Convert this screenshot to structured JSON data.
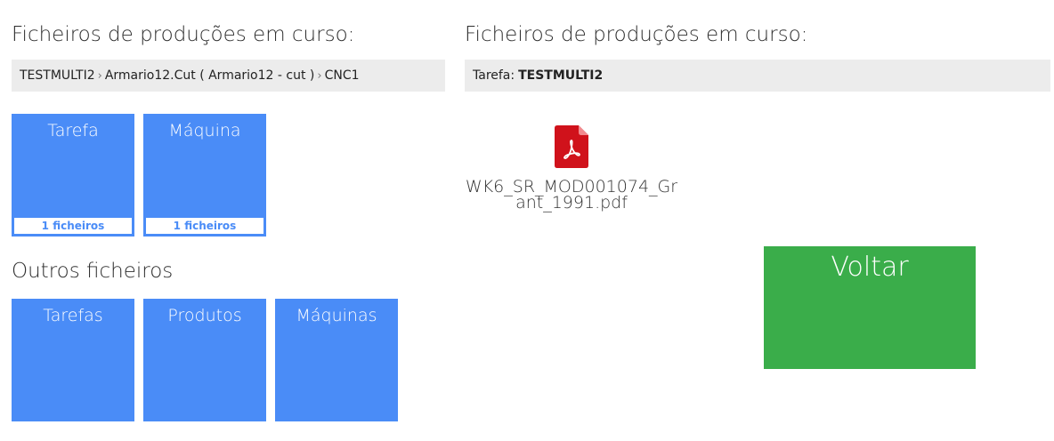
{
  "left": {
    "heading": "Ficheiros de produções em curso:",
    "breadcrumb": [
      "TESTMULTI2",
      "Armario12.Cut ( Armario12 - cut )",
      "CNC1"
    ],
    "breadcrumb_separator": "›",
    "tiles": [
      {
        "label": "Tarefa",
        "badge": "1 ficheiros"
      },
      {
        "label": "Máquina",
        "badge": "1 ficheiros"
      }
    ],
    "others_heading": "Outros ficheiros",
    "other_tiles": [
      {
        "label": "Tarefas"
      },
      {
        "label": "Produtos"
      },
      {
        "label": "Máquinas"
      }
    ]
  },
  "right": {
    "heading": "Ficheiros de produções em curso:",
    "task_label": "Tarefa:",
    "task_value": "TESTMULTI2",
    "files": [
      {
        "name": "WK6_SR_MOD001074_Grant_1991.pdf",
        "icon": "pdf-file-icon"
      }
    ],
    "back_button": "Voltar"
  },
  "colors": {
    "tile_blue": "#4a8cf7",
    "back_green": "#3aad4a",
    "bar_gray": "#ececec",
    "pdf_red": "#d0121b"
  }
}
